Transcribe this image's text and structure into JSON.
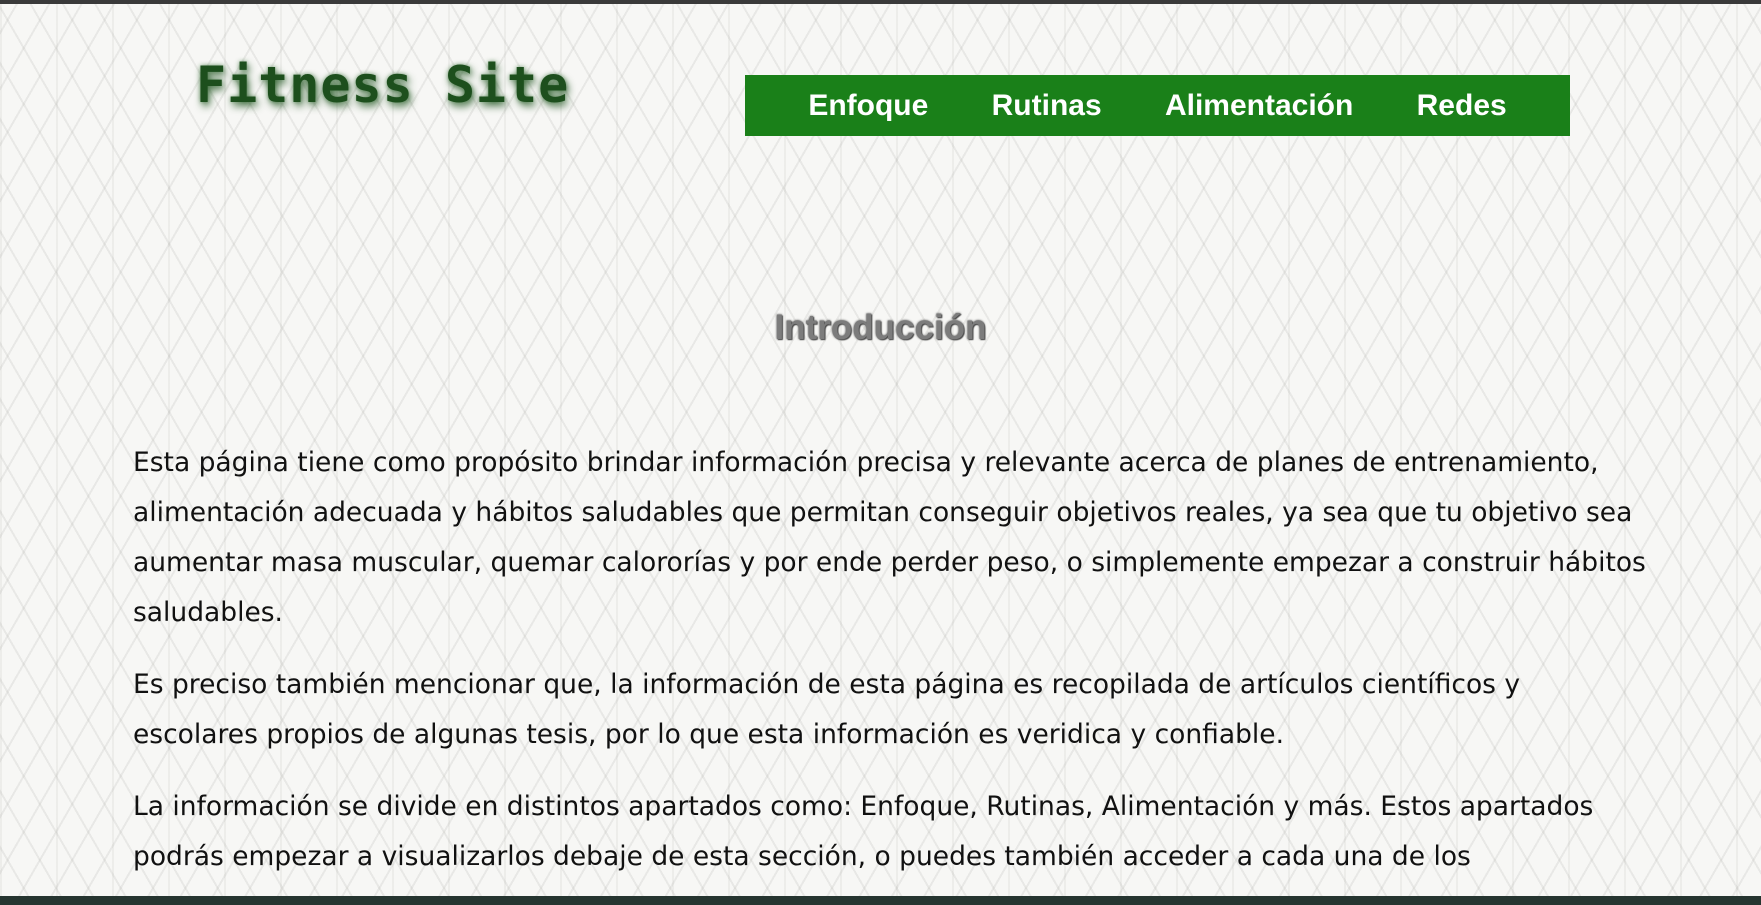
{
  "header": {
    "site_title": "Fitness Site"
  },
  "nav": {
    "items": [
      {
        "label": "Enfoque"
      },
      {
        "label": "Rutinas"
      },
      {
        "label": "Alimentación"
      },
      {
        "label": "Redes"
      }
    ]
  },
  "main": {
    "heading": "Introducción",
    "paragraphs": [
      "Esta página tiene como propósito brindar información precisa y relevante acerca de planes de entrenamiento, alimentación adecuada y hábitos saludables que permitan conseguir objetivos reales, ya sea que tu objetivo sea aumentar masa muscular, quemar calororías y por ende perder peso, o simplemente empezar a construir hábitos saludables.",
      "Es preciso también mencionar que, la información de esta página es recopilada de artículos científicos y escolares propios de algunas tesis, por lo que esta información es veridica y confiable.",
      "La información se divide en distintos apartados como: Enfoque, Rutinas, Alimentación y más. Estos apartados podrás empezar a visualizarlos debaje de esta sección, o puedes también acceder a cada una de los"
    ]
  },
  "colors": {
    "nav_background": "#1a8019",
    "title_color": "#1d4f1d",
    "heading_color": "#7c7c7c"
  }
}
